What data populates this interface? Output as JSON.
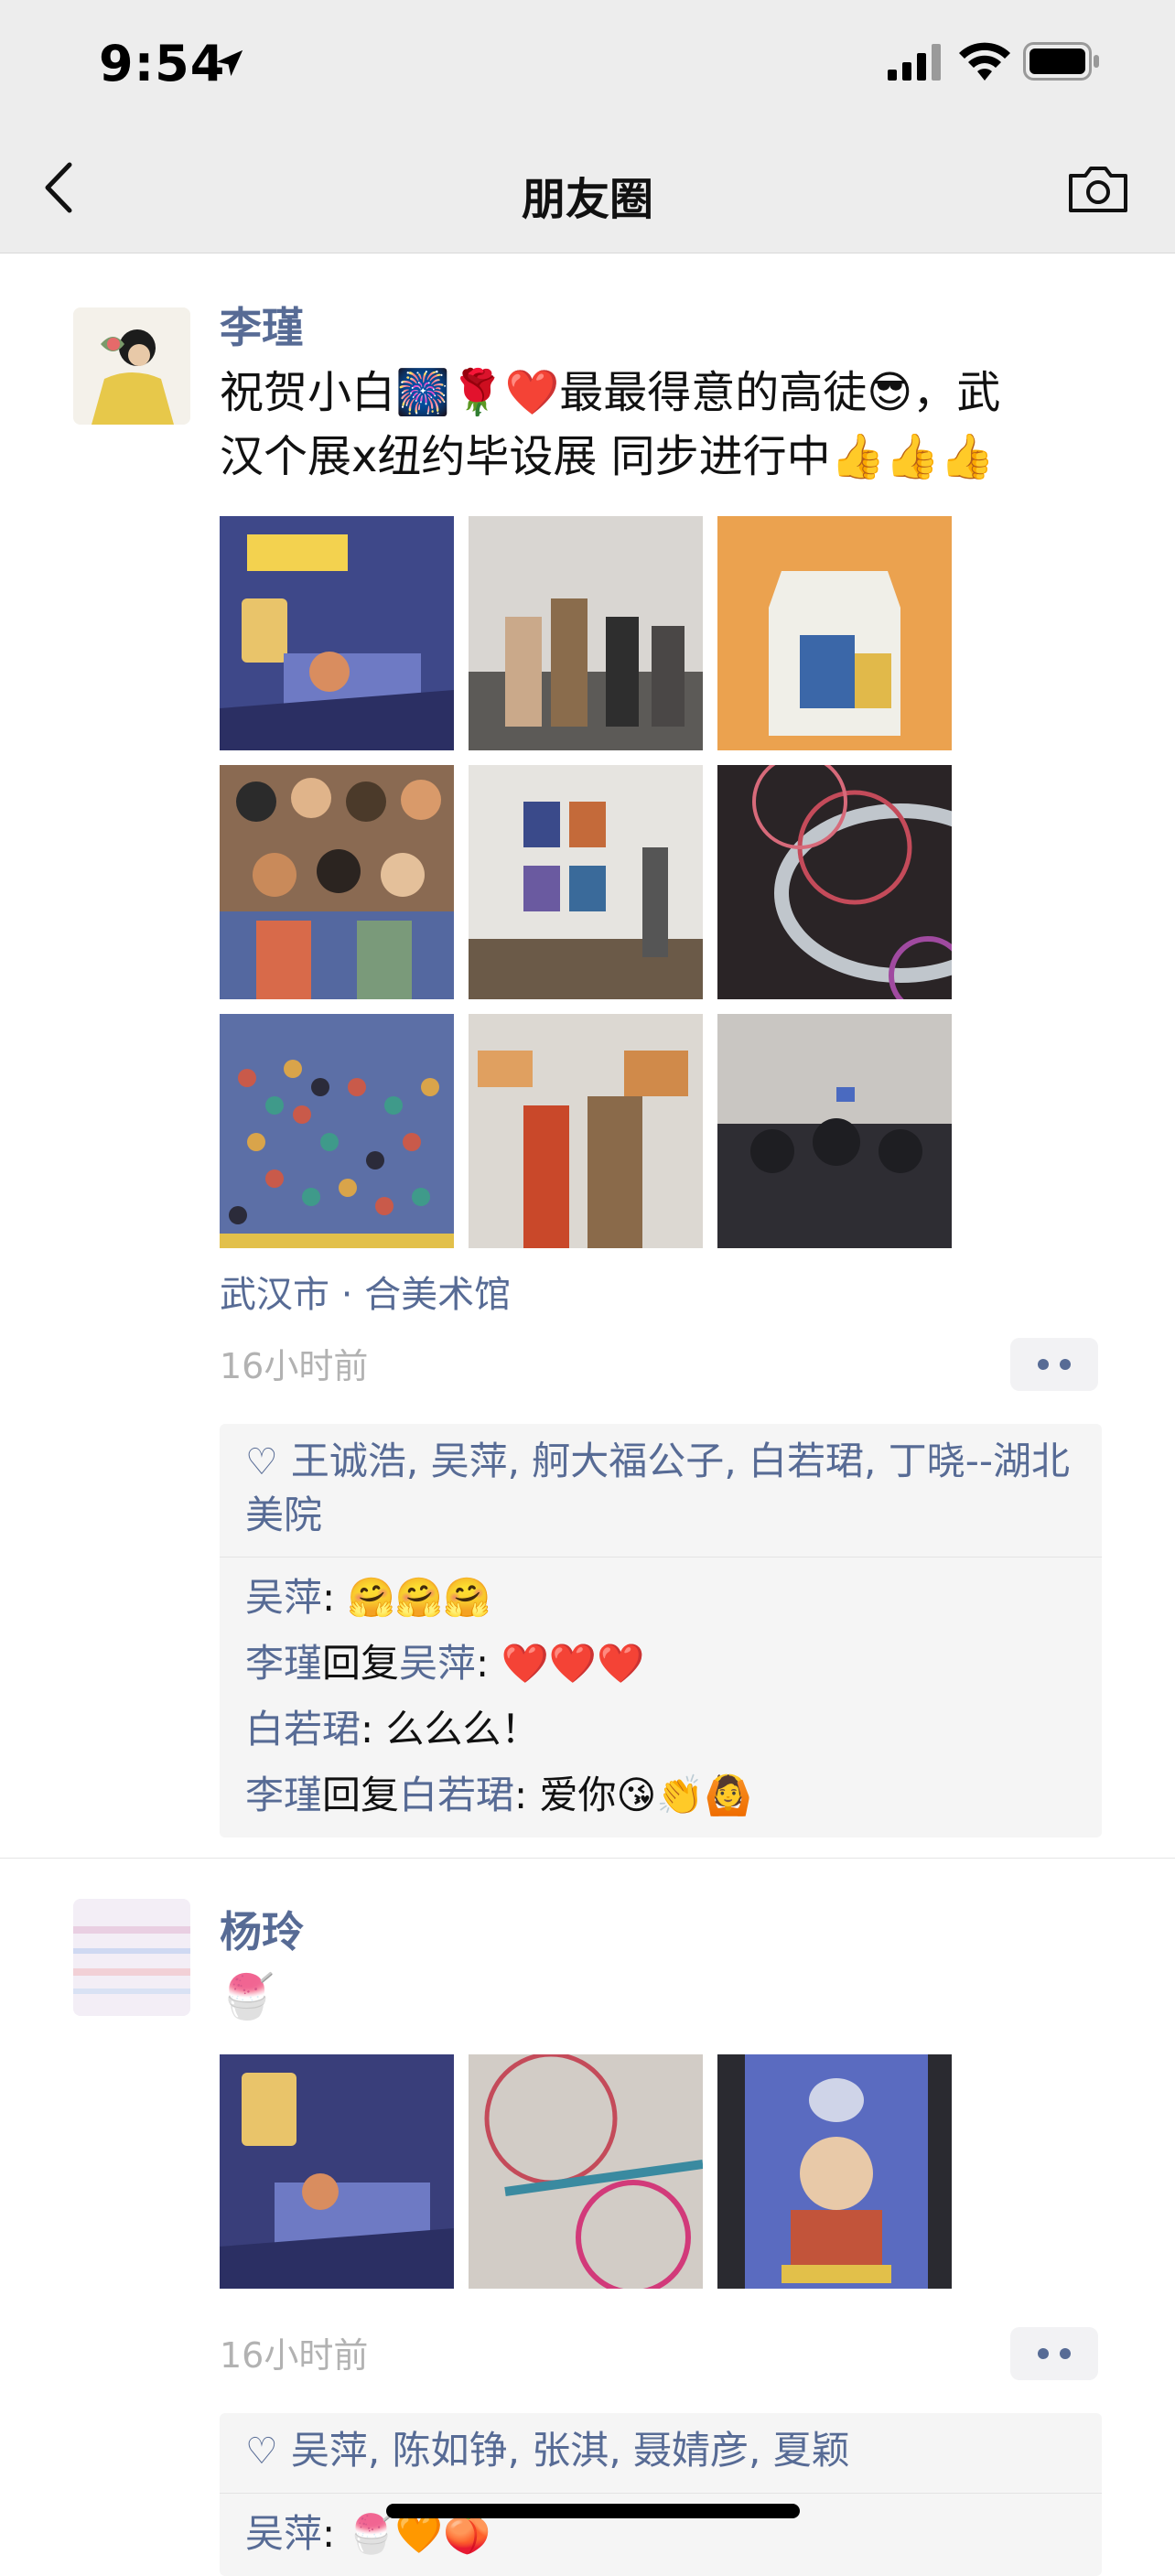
{
  "status_bar": {
    "time": "9:54"
  },
  "nav": {
    "title": "朋友圈"
  },
  "post1": {
    "author": "李瑾",
    "text_line1": "祝贺小白🎆🌹❤️最最得意的高徒😎，武",
    "text_line2": "汉个展x纽约毕设展 同步进行中👍👍👍",
    "location": "武汉市 · 合美术馆",
    "time": "16小时前",
    "likes": [
      "王诚浩",
      "吴萍",
      "舸大福公子",
      "白若珺",
      "丁晓--湖北美院"
    ],
    "comments": [
      {
        "from": "吴萍",
        "to": "",
        "text": ": 🤗🤗🤗"
      },
      {
        "from": "李瑾",
        "reply": "回复",
        "to": "吴萍",
        "text": ": ❤️❤️❤️"
      },
      {
        "from": "白若珺",
        "to": "",
        "text": ": 么么么！"
      },
      {
        "from": "李瑾",
        "reply": "回复",
        "to": "白若珺",
        "text": ": 爱你😘👏🙆"
      }
    ],
    "images": [
      {
        "desc": "poster",
        "color": "#3f4a8a"
      },
      {
        "desc": "gallery crowd",
        "color": "#6b6a68"
      },
      {
        "desc": "orange illustration",
        "color": "#e9a24f"
      },
      {
        "desc": "crowd illustration",
        "color": "#a17b5b"
      },
      {
        "desc": "gallery wall",
        "color": "#8c8a86"
      },
      {
        "desc": "rings",
        "color": "#4a3a3a"
      },
      {
        "desc": "balls illustration",
        "color": "#6c7a9a"
      },
      {
        "desc": "viewers",
        "color": "#a09890"
      },
      {
        "desc": "gallery crowd 2",
        "color": "#2e2e35"
      }
    ]
  },
  "post2": {
    "author": "杨玲",
    "text": "🍧",
    "time": "16小时前",
    "likes": [
      "吴萍",
      "陈如铮",
      "张淇",
      "聂婧彦",
      "夏颖"
    ],
    "comments": [
      {
        "from": "吴萍",
        "to": "",
        "text": ": 🍧🧡🍑"
      }
    ],
    "images": [
      {
        "desc": "poster",
        "color": "#3a3f7a"
      },
      {
        "desc": "rings",
        "color": "#c9c3bd"
      },
      {
        "desc": "card",
        "color": "#5a6bc0"
      }
    ]
  }
}
